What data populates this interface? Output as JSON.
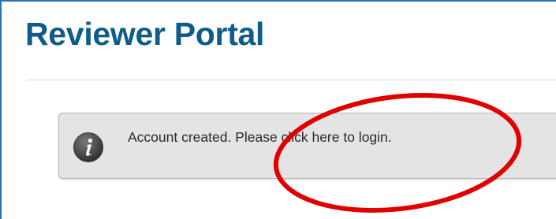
{
  "header": {
    "title": "Reviewer Portal"
  },
  "alert": {
    "icon": "info-icon",
    "message": "Account created.",
    "link_text": "Please click here to login."
  },
  "colors": {
    "title": "#0e5c8a",
    "frame_border": "#2f6db5",
    "alert_background": "#e4e4e4",
    "annotation": "#e00000"
  }
}
